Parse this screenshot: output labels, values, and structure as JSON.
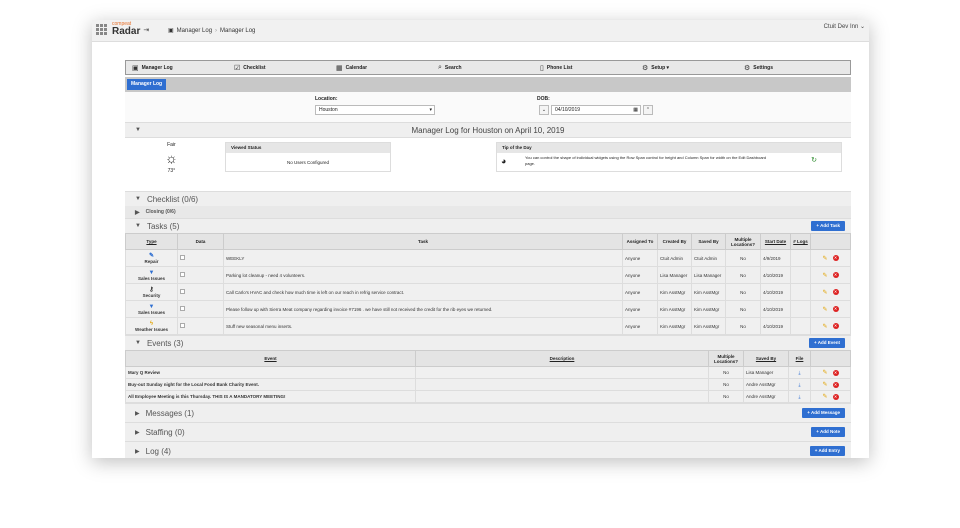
{
  "app": {
    "brand_top": "compeat",
    "brand": "Radar",
    "crumb1": "Manager Log",
    "crumb2": "Manager Log",
    "user": "Ctuit Dev Inn ⌄"
  },
  "nav": [
    {
      "label": "Manager Log",
      "icon": "book-icon"
    },
    {
      "label": "Checklist",
      "icon": "checklist-icon"
    },
    {
      "label": "Calendar",
      "icon": "calendar-icon"
    },
    {
      "label": "Search",
      "icon": "search-icon"
    },
    {
      "label": "Phone List",
      "icon": "phone-icon"
    },
    {
      "label": "Setup ▾",
      "icon": "gear-icon"
    },
    {
      "label": "Settings",
      "icon": "gear-icon"
    }
  ],
  "subnav": {
    "tab": "Manager Log"
  },
  "filters": {
    "location_label": "Location:",
    "location_value": "Houston",
    "dob_label": "DOB:",
    "dob_value": "04/10/2019"
  },
  "daily": {
    "title": "Manager Log for Houston on April 10, 2019",
    "weather": "Fair",
    "temp": "73°",
    "viewed_title": "Viewed Status",
    "viewed_text": "No Users Configured",
    "tip_title": "Tip of the Day",
    "tip_text": "You can control the shape of individual widgets using the Row Span control for height and Column Span for width on the Edit Dashboard page."
  },
  "checklist": {
    "title": "Checklist (0/6)",
    "sub": "Closing (0/6)"
  },
  "tasks": {
    "title": "Tasks (5)",
    "add": "+ Add Task",
    "headers": [
      "Type",
      "Data",
      "Task",
      "Assigned To",
      "Created By",
      "Saved By",
      "Multiple Locations?",
      "Start Date",
      "# Logs"
    ],
    "rows": [
      {
        "type": "Repair",
        "task": "WEEKLY",
        "assigned": "Anyone",
        "created": "Ctuit Admin",
        "saved": "Ctuit Admin",
        "multi": "No",
        "start": "4/9/2019"
      },
      {
        "type": "Sales Issues",
        "task": "Parking lot cleanup - need 4 volunteers.",
        "assigned": "Anyone",
        "created": "Lisa Manager",
        "saved": "Lisa Manager",
        "multi": "No",
        "start": "4/10/2019"
      },
      {
        "type": "Security",
        "task": "Call Carlo's HVAC and check how much time is left on our reach in refrig service contract.",
        "assigned": "Anyone",
        "created": "Kim AsstMgr",
        "saved": "Kim AsstMgr",
        "multi": "No",
        "start": "4/10/2019"
      },
      {
        "type": "Sales Issues",
        "task": "Please follow up with Sierra Meat company regarding invoice #7196 . we have still not received the credit for the rib eyes we returned.",
        "assigned": "Anyone",
        "created": "Kim AsstMgr",
        "saved": "Kim AsstMgr",
        "multi": "No",
        "start": "4/10/2019"
      },
      {
        "type": "Weather Issues",
        "task": "Stuff new seasonal menu inserts.",
        "assigned": "Anyone",
        "created": "Kim AsstMgr",
        "saved": "Kim AsstMgr",
        "multi": "No",
        "start": "4/10/2019"
      }
    ]
  },
  "events": {
    "title": "Events (3)",
    "add": "+ Add Event",
    "headers": [
      "Event",
      "Description",
      "Multiple Locations?",
      "Saved By",
      "File"
    ],
    "rows": [
      {
        "event": "Mary Q Review",
        "multi": "No",
        "saved": "Lisa Manager"
      },
      {
        "event": "Buy-out Sunday night for the Local Food Bank Charity Event.",
        "multi": "No",
        "saved": "Andre AsstMgr"
      },
      {
        "event": "All Employee Meeting is this Thursday. THIS IS A MANDATORY MEETING!",
        "multi": "No",
        "saved": "Andre AsstMgr"
      }
    ]
  },
  "messages": {
    "title": "Messages (1)",
    "add": "+ Add Message"
  },
  "staffing": {
    "title": "Staffing (0)",
    "add": "+ Add Note"
  },
  "log": {
    "title": "Log (4)",
    "add": "+ Add Entry"
  }
}
